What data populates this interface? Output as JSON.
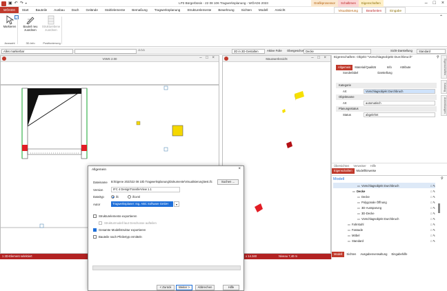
{
  "app": {
    "title": "LP3 Bürgerbüsis - 22 08 106 Tragwerksplanung - WÖADö 2023",
    "ctx_tabs": [
      "Grafikprosessor",
      "Schalbmen",
      "Eigenschaften"
    ],
    "ctx_subtabs": [
      "Visualisierung",
      "Bearbeiten",
      "Eingabe"
    ]
  },
  "ribbon_tabs": [
    "WÖADö",
    "Start",
    "Bauteile",
    "Ausbau",
    "Dach",
    "Gelände",
    "Stahlelemente",
    "Bemaßung",
    "Tragwerksplanung",
    "Strukturelemente",
    "Bewehrung",
    "Sichten",
    "Modell",
    "Ansicht"
  ],
  "ribbon": {
    "buttons": [
      {
        "label": "Markieren",
        "icon": "cursor-icon"
      },
      {
        "label": "Bauteil neu zuordnen",
        "icon": "pen-icon"
      },
      {
        "label": "Strukturebene zuordnen",
        "icon": "grid-icon"
      }
    ],
    "groups": [
      "Auswahl",
      "3D-Info",
      "Positionierung"
    ]
  },
  "optbar": {
    "layer_combo": "Alles markierbar",
    "view_combo": "2D in 2D-Gestalten",
    "active_floor": "Aktive Folie",
    "upper_floor": "Obergeschoss",
    "floor_value": "Decke",
    "sichtdarstellung_label": "Sicht-Darstellung",
    "sichtdarstellung_value": "Standard"
  },
  "panes": {
    "left_title": "VIWS 2.00",
    "right_title": "Mauswerkssicht"
  },
  "statusbar": {
    "left": "1 2D-Element selektiert",
    "coords": "x 14.340",
    "level": "Niveau 7,40 m"
  },
  "properties": {
    "title": "Eigenschaften: Objekt \"Vorschlagsobjekt Durchbruch\"",
    "tabs": [
      "Allgemein",
      "Material/Qualität",
      "Info",
      "Attribute"
    ],
    "subtabs": [
      "Sonderlabel",
      "Darstellung"
    ],
    "sections": [
      {
        "name": "Kategorie",
        "rows": [
          {
            "label": "Art",
            "value": "Vorschlagsobjekt Durchbruch"
          }
        ]
      },
      {
        "name": "Objektname",
        "rows": [
          {
            "label": "Art",
            "value": "automatisch"
          }
        ]
      },
      {
        "name": "Planungsstatus",
        "rows": [
          {
            "label": "Status",
            "value": "abgelehnt"
          }
        ]
      }
    ],
    "bottom_tabs": [
      "Übersichten",
      "Verweiser",
      "Hilfe"
    ],
    "bottom_tabs2": [
      "Eigenschaften",
      "Modellhinweise"
    ]
  },
  "model": {
    "header": "Modell",
    "rows": [
      {
        "label": "Vorschlagsobjekt Durchbruch",
        "indent": 5
      },
      {
        "label": "Decke",
        "indent": 4,
        "bold": true
      },
      {
        "label": "Decke",
        "indent": 5
      },
      {
        "label": "Polygonale Öffnung",
        "indent": 5
      },
      {
        "label": "3D-Aussparung",
        "indent": 5
      },
      {
        "label": "3D-Decke",
        "indent": 5
      },
      {
        "label": "Vorschlagsobjekt Durchbruch",
        "indent": 5
      },
      {
        "label": "Fahrstuhl",
        "indent": 3
      },
      {
        "label": "Fassade",
        "indent": 3
      },
      {
        "label": "Möbel",
        "indent": 3
      },
      {
        "label": "Standard",
        "indent": 3
      }
    ],
    "footer_tabs": [
      "Modell",
      "Sichten",
      "Ausgabenverwaltung",
      "Eingabehilfe"
    ]
  },
  "dialog": {
    "title": "Allgemein",
    "filename_label": "Dateiname",
    "filename_value": "B:\\Eigene 2023\\22 08 10b Tragwerksplanung\\Dokumente\\Visualisierung\\test.ifc",
    "browse_button": "Suchen ...",
    "version_label": "Version",
    "version_value": "IFC 4 DesignTransferView 1.1",
    "filetype_label": "Dateityp",
    "filetype_opt1": "ifc",
    "filetype_opt2": "ifcxml",
    "author_label": "Autor",
    "author_value": "Tragwerksplaner: Ing. ABC Software GmbH",
    "cb1": "Strukturelemente exportieren",
    "cb2": "Strukturmodell laut Geschosse aufteilen",
    "cb3": "Gesamte Modellstruktur exportieren",
    "cb4": "Bauteile nach Pfeilertyp ermitteln",
    "back_button": "< Zurück",
    "next_button": "Weiter >",
    "cancel_button": "Abbrechen",
    "help_button": "Hilfe"
  },
  "colors": {
    "accent": "#c0392b",
    "highlight": "#1e6fd9",
    "yellow": "#f5d800",
    "red": "#d9141c"
  }
}
